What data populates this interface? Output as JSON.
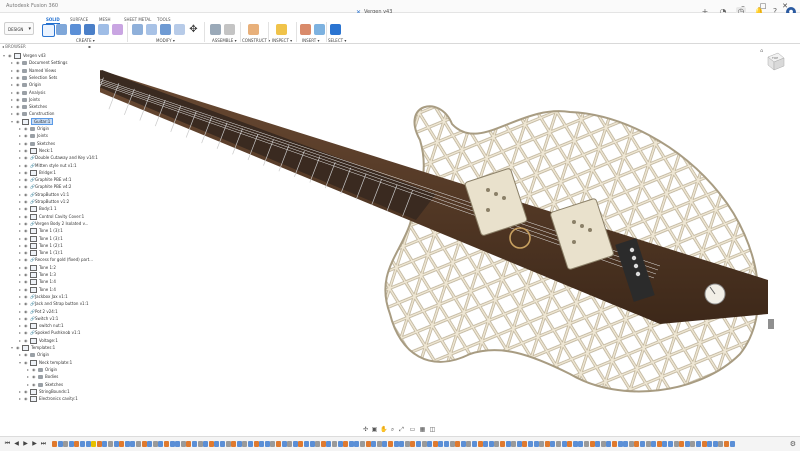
{
  "app": {
    "title": "Autodesk Fusion 360",
    "document_tab": "Vergen v43"
  },
  "ribbon": {
    "workspace_button": "DESIGN",
    "tabs": [
      {
        "label": "SOLID",
        "active": true
      },
      {
        "label": "SURFACE",
        "active": false
      },
      {
        "label": "MESH",
        "active": false
      },
      {
        "label": "SHEET METAL",
        "active": false
      },
      {
        "label": "TOOLS",
        "active": false
      }
    ],
    "groups": [
      "CREATE ▾",
      "MODIFY ▾",
      "ASSEMBLE ▾",
      "CONSTRUCT ▾",
      "INSPECT ▾",
      "INSERT ▾",
      "SELECT ▾"
    ]
  },
  "browser": {
    "header": "BROWSER",
    "rows": [
      {
        "label": "Vergen v43",
        "type": "comp",
        "indent": 0,
        "expanded": true
      },
      {
        "label": "Document Settings",
        "type": "fold",
        "indent": 1
      },
      {
        "label": "Named Views",
        "type": "fold",
        "indent": 1
      },
      {
        "label": "Selection Sets",
        "type": "fold",
        "indent": 1
      },
      {
        "label": "Origin",
        "type": "fold",
        "indent": 1
      },
      {
        "label": "Analysis",
        "type": "fold",
        "indent": 1
      },
      {
        "label": "Joints",
        "type": "fold",
        "indent": 1
      },
      {
        "label": "Sketches",
        "type": "fold",
        "indent": 1
      },
      {
        "label": "Construction",
        "type": "fold",
        "indent": 1
      },
      {
        "label": "Guitar:1",
        "type": "comp",
        "indent": 1,
        "expanded": true,
        "active": true
      },
      {
        "label": "Origin",
        "type": "fold",
        "indent": 2
      },
      {
        "label": "Joints",
        "type": "fold",
        "indent": 2
      },
      {
        "label": "Sketches",
        "type": "fold",
        "indent": 2
      },
      {
        "label": "Neck:1",
        "type": "comp",
        "indent": 2
      },
      {
        "label": "Double Cutaway and Key v14:1",
        "type": "link",
        "indent": 2
      },
      {
        "label": "Mitten style nut v1:1",
        "type": "link",
        "indent": 2
      },
      {
        "label": "Bridge:1",
        "type": "comp",
        "indent": 2
      },
      {
        "label": "Graphite PBE v4:1",
        "type": "link",
        "indent": 2
      },
      {
        "label": "Graphite PBE v4:2",
        "type": "link",
        "indent": 2
      },
      {
        "label": "StrapButton v1:1",
        "type": "link",
        "indent": 2
      },
      {
        "label": "StrapButton v1:2",
        "type": "link",
        "indent": 2
      },
      {
        "label": "Body:1 1",
        "type": "comp",
        "indent": 2
      },
      {
        "label": "Control Cavity Cover:1",
        "type": "comp",
        "indent": 2
      },
      {
        "label": "Vergen Body 2 Isolated v...",
        "type": "link",
        "indent": 2
      },
      {
        "label": "Tone 1 (3):1",
        "type": "comp",
        "indent": 2
      },
      {
        "label": "Tone 1 (3):1",
        "type": "comp",
        "indent": 2
      },
      {
        "label": "Tone 1 (2):1",
        "type": "comp",
        "indent": 2
      },
      {
        "label": "Tone 1 (1):1",
        "type": "comp",
        "indent": 2
      },
      {
        "label": "Recess for gold (fixed) part...",
        "type": "link",
        "indent": 2
      },
      {
        "label": "Tone 1:2",
        "type": "comp",
        "indent": 2
      },
      {
        "label": "Tone 1:3",
        "type": "comp",
        "indent": 2
      },
      {
        "label": "Tone 1:4",
        "type": "comp",
        "indent": 2
      },
      {
        "label": "Tone 1:4",
        "type": "comp",
        "indent": 2
      },
      {
        "label": "Jackbox Jax v1:1",
        "type": "link",
        "indent": 2
      },
      {
        "label": "Jack and Strap button v1:1",
        "type": "link",
        "indent": 2
      },
      {
        "label": "Pot 2 v24:1",
        "type": "link",
        "indent": 2
      },
      {
        "label": "Switch v1:1",
        "type": "link",
        "indent": 2
      },
      {
        "label": "switch nut:1",
        "type": "comp",
        "indent": 2
      },
      {
        "label": "Spoked Pushknob v1:1",
        "type": "link",
        "indent": 2
      },
      {
        "label": "Voltage:1",
        "type": "comp",
        "indent": 2
      },
      {
        "label": "Templates:1",
        "type": "comp",
        "indent": 1,
        "expanded": true
      },
      {
        "label": "Origin",
        "type": "fold",
        "indent": 2
      },
      {
        "label": "Neck template:1",
        "type": "comp",
        "indent": 2,
        "expanded": true
      },
      {
        "label": "Origin",
        "type": "fold",
        "indent": 3
      },
      {
        "label": "Bodies",
        "type": "fold",
        "indent": 3
      },
      {
        "label": "Sketches",
        "type": "fold",
        "indent": 3
      },
      {
        "label": "StringBounds:1",
        "type": "comp",
        "indent": 2
      },
      {
        "label": "Electronics cavity:1",
        "type": "comp",
        "indent": 2
      }
    ]
  },
  "viewcube": {
    "face": "TOP"
  },
  "timeline": {
    "feature_count": 122,
    "colors": {
      "sketch": "#e07a2e",
      "solid": "#5b8fd6",
      "comp": "#9a9a9a",
      "marker": "#e6c000"
    }
  },
  "colors": {
    "accent": "#1f6fd0",
    "body_lattice": "#e8dfc9",
    "neck_wood": "#5a3b26",
    "fretboard": "#3a2a20"
  }
}
